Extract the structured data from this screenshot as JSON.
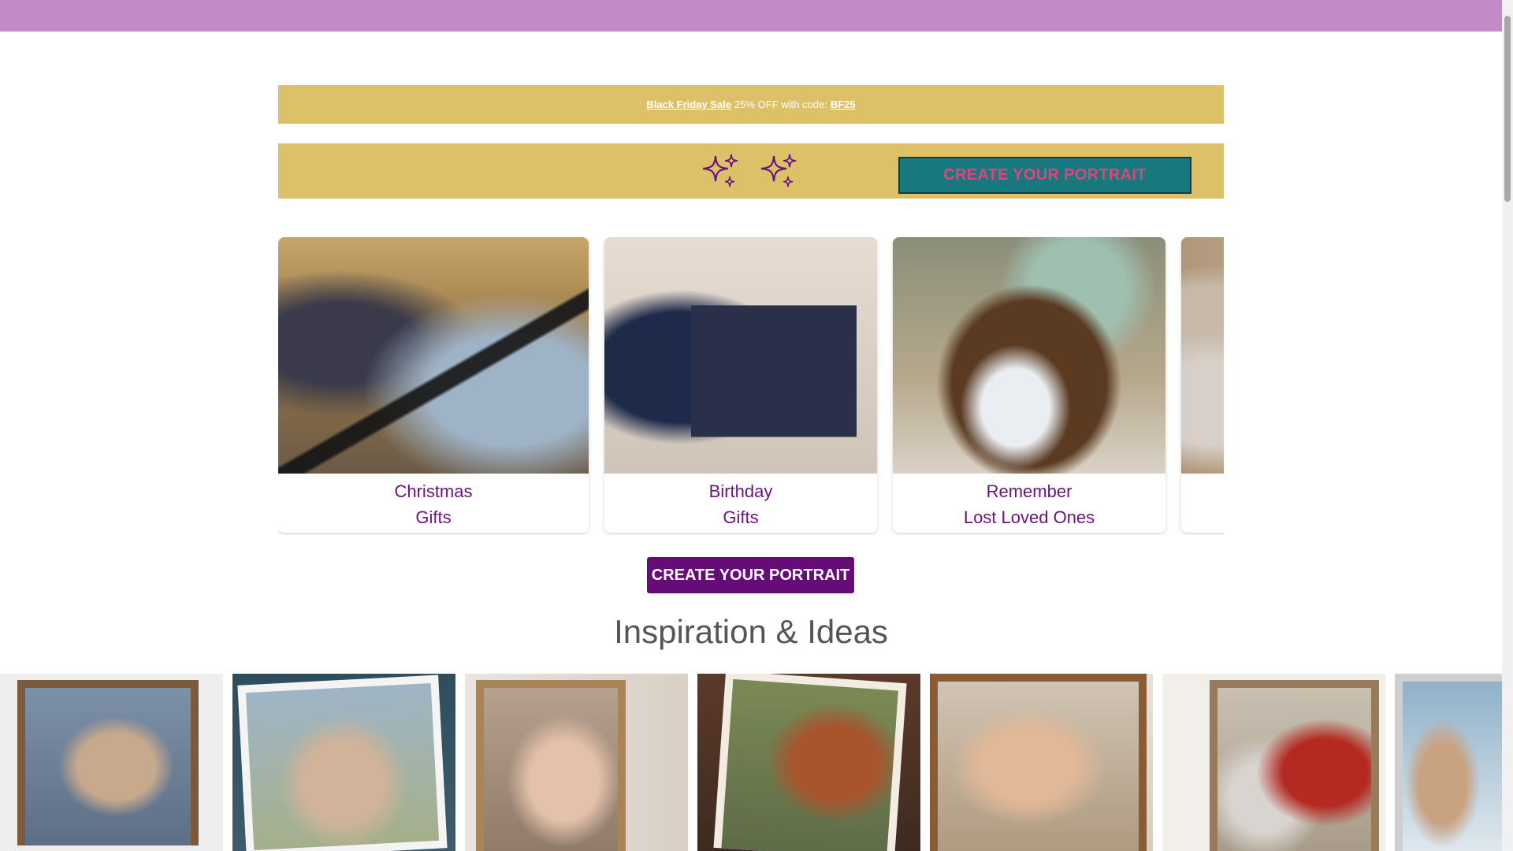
{
  "promo": {
    "sale_label": "Black Friday Sale",
    "offer_text": "25% OFF with code:",
    "code": "BF25"
  },
  "header": {
    "cta_label": "CREATE YOUR PORTRAIT"
  },
  "occasions": [
    {
      "line1": "Christmas",
      "line2": "Gifts"
    },
    {
      "line1": "Birthday",
      "line2": "Gifts"
    },
    {
      "line1": "Remember",
      "line2": "Lost Loved Ones"
    },
    {
      "line1": "",
      "line2": ""
    }
  ],
  "main_cta": {
    "label": "CREATE YOUR PORTRAIT"
  },
  "inspiration": {
    "title": "Inspiration & Ideas"
  },
  "colors": {
    "topbar": "#c38ac8",
    "promo": "#dcc168",
    "teal": "#17797e",
    "pink": "#e2447a",
    "purple": "#660c78",
    "caption": "#6b1480"
  }
}
